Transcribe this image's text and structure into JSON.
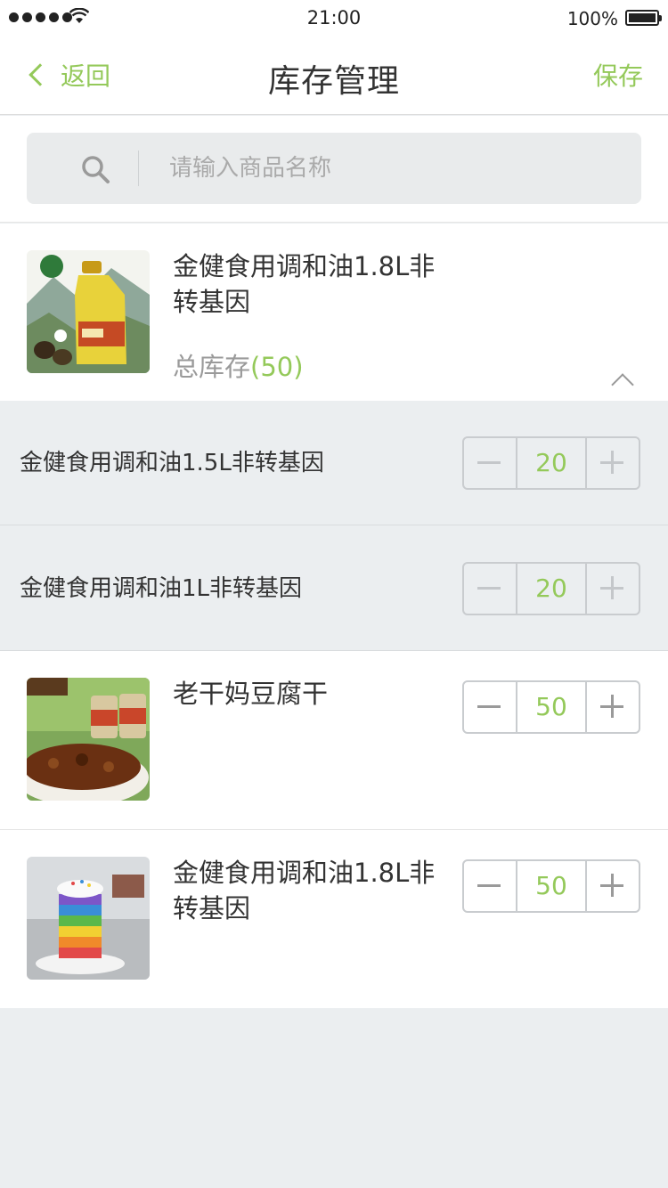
{
  "status_bar": {
    "time": "21:00",
    "battery": "100%"
  },
  "nav": {
    "back_label": "返回",
    "title": "库存管理",
    "save_label": "保存"
  },
  "search": {
    "placeholder": "请输入商品名称"
  },
  "products": [
    {
      "name": "金健食用调和油1.8L非转基因",
      "total_label": "总库存",
      "total_value": "(50)",
      "variants": [
        {
          "name": "金健食用调和油1.5L非转基因",
          "qty": "20"
        },
        {
          "name": "金健食用调和油1L非转基因",
          "qty": "20"
        }
      ]
    },
    {
      "name": "老干妈豆腐干",
      "qty": "50"
    },
    {
      "name": "金健食用调和油1.8L非转基因",
      "qty": "50"
    }
  ],
  "colors": {
    "accent": "#94c95a",
    "background": "#ebeef0"
  }
}
